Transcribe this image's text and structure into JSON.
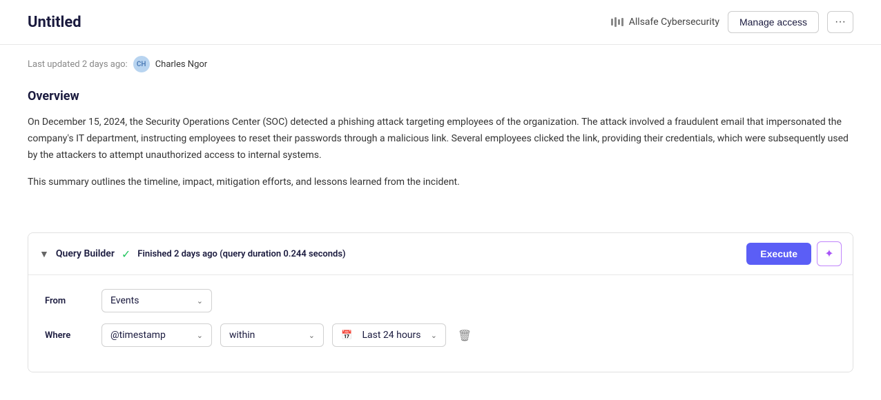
{
  "header": {
    "title": "Untitled",
    "org_icon_label": "org-icon",
    "org_name": "Allsafe Cybersecurity",
    "manage_access_label": "Manage access",
    "more_button_label": "···"
  },
  "meta": {
    "last_updated": "Last updated 2 days ago:",
    "avatar_initials": "CH",
    "author": "Charles Ngor"
  },
  "overview": {
    "section_title": "Overview",
    "paragraph1": "On December 15, 2024, the Security Operations Center (SOC) detected a phishing attack targeting employees of the organization. The attack involved a fraudulent email that impersonated the company's IT department, instructing employees to reset their passwords through a malicious link. Several employees clicked the link, providing their credentials, which were subsequently used by the attackers to attempt unauthorized access to internal systems.",
    "paragraph2": "This summary outlines the timeline, impact, mitigation efforts, and lessons learned from the incident."
  },
  "query_builder": {
    "label": "Query Builder",
    "status": "Finished 2 days ago (query duration 0.244 seconds)",
    "execute_label": "Execute",
    "from_label": "From",
    "where_label": "Where",
    "from_value": "Events",
    "timestamp_value": "@timestamp",
    "within_value": "within",
    "time_value": "Last 24 hours"
  }
}
